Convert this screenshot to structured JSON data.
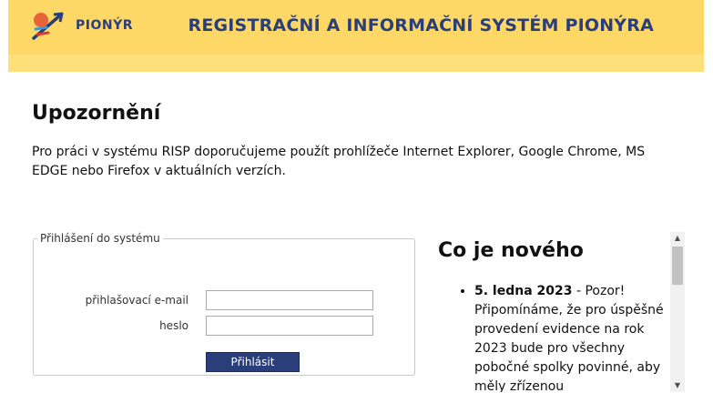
{
  "header": {
    "logo_text": "PIONÝR",
    "title": "REGISTRAČNÍ A INFORMAČNÍ SYSTÉM PIONÝRA"
  },
  "notice": {
    "heading": "Upozornění",
    "text": "Pro práci v systému RISP doporučujeme použít prohlížeče Internet Explorer, Google Chrome, MS EDGE nebo Firefox v aktuálních verzích."
  },
  "login": {
    "legend": "Přihlášení do systému",
    "email_label": "přihlašovací e-mail",
    "email_value": "",
    "password_label": "heslo",
    "password_value": "",
    "submit_label": "Přihlásit"
  },
  "news": {
    "heading": "Co je nového",
    "items": [
      {
        "date": "5. ledna 2023",
        "text": " - Pozor! Připomínáme, že pro úspěšné provedení evidence na rok 2023 bude pro všechny pobočné spolky povinné, aby měly zřízenou"
      }
    ]
  },
  "scrollbar": {
    "up_icon": "triangle-up",
    "down_icon": "triangle-down"
  },
  "colors": {
    "header_bg": "#fdd866",
    "brand": "#2a3f7a",
    "button_bg": "#2a3f7a"
  }
}
